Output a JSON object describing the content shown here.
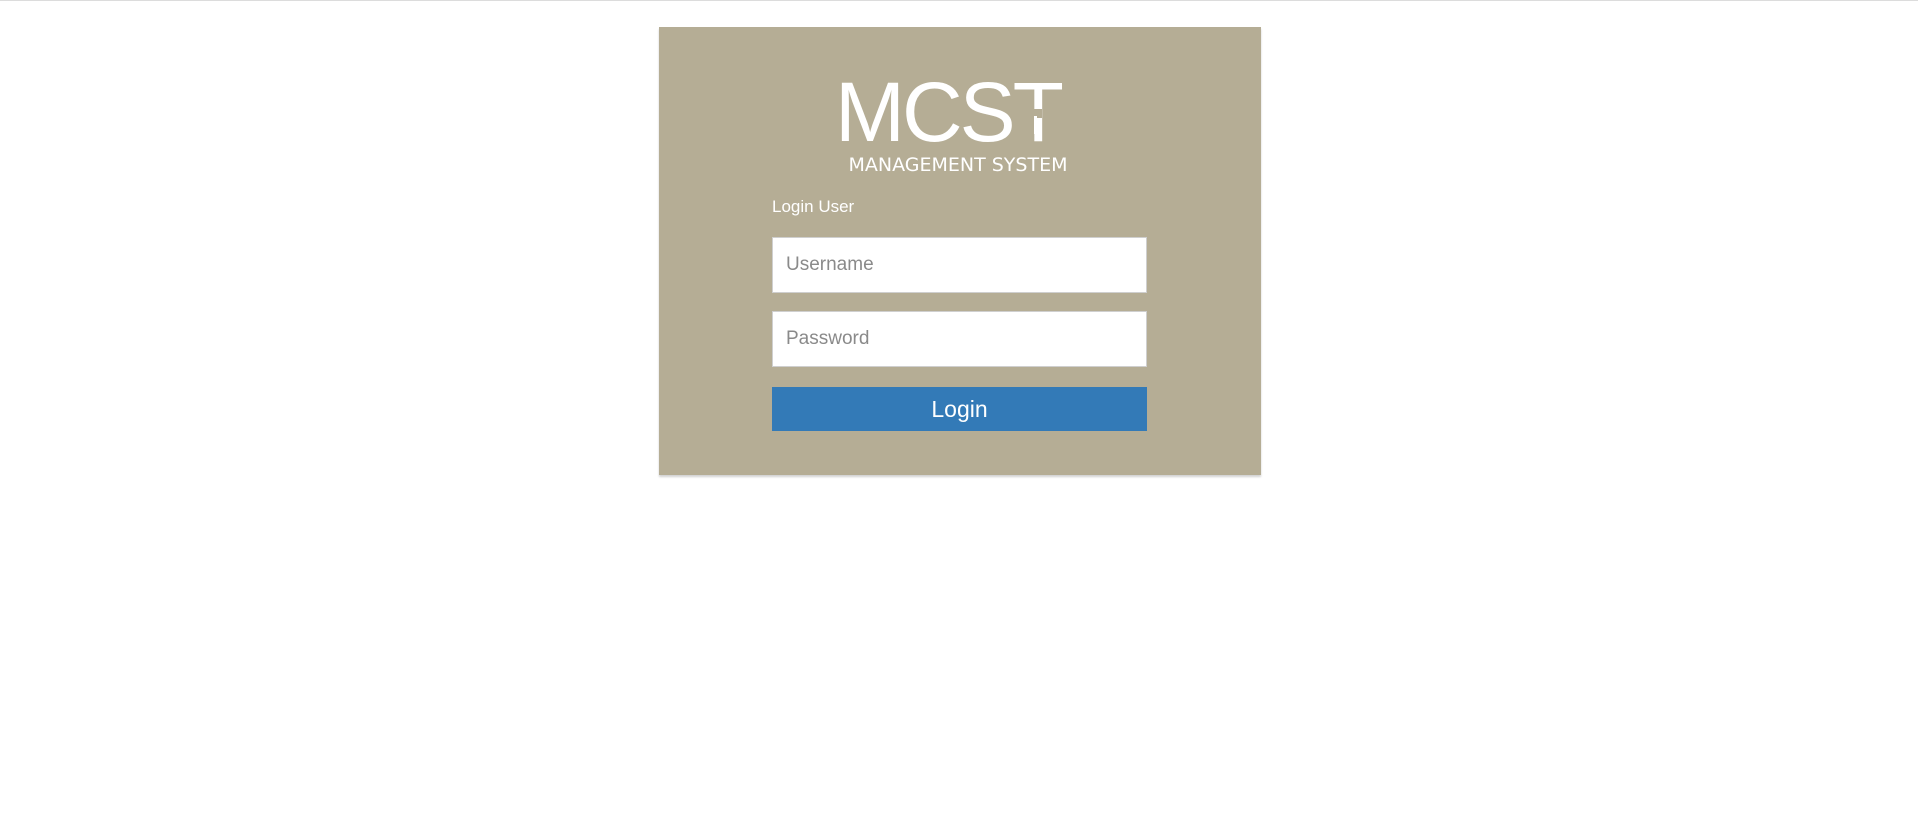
{
  "brand": {
    "logo_main": "MCST",
    "logo_tagline": "MANAGEMENT SYSTEM"
  },
  "login_form": {
    "heading": "Login User",
    "username_placeholder": "Username",
    "password_placeholder": "Password",
    "submit_label": "Login"
  },
  "colors": {
    "panel_background": "#b5ad95",
    "login_button": "#337ab7",
    "logo_text": "#ffffff"
  }
}
